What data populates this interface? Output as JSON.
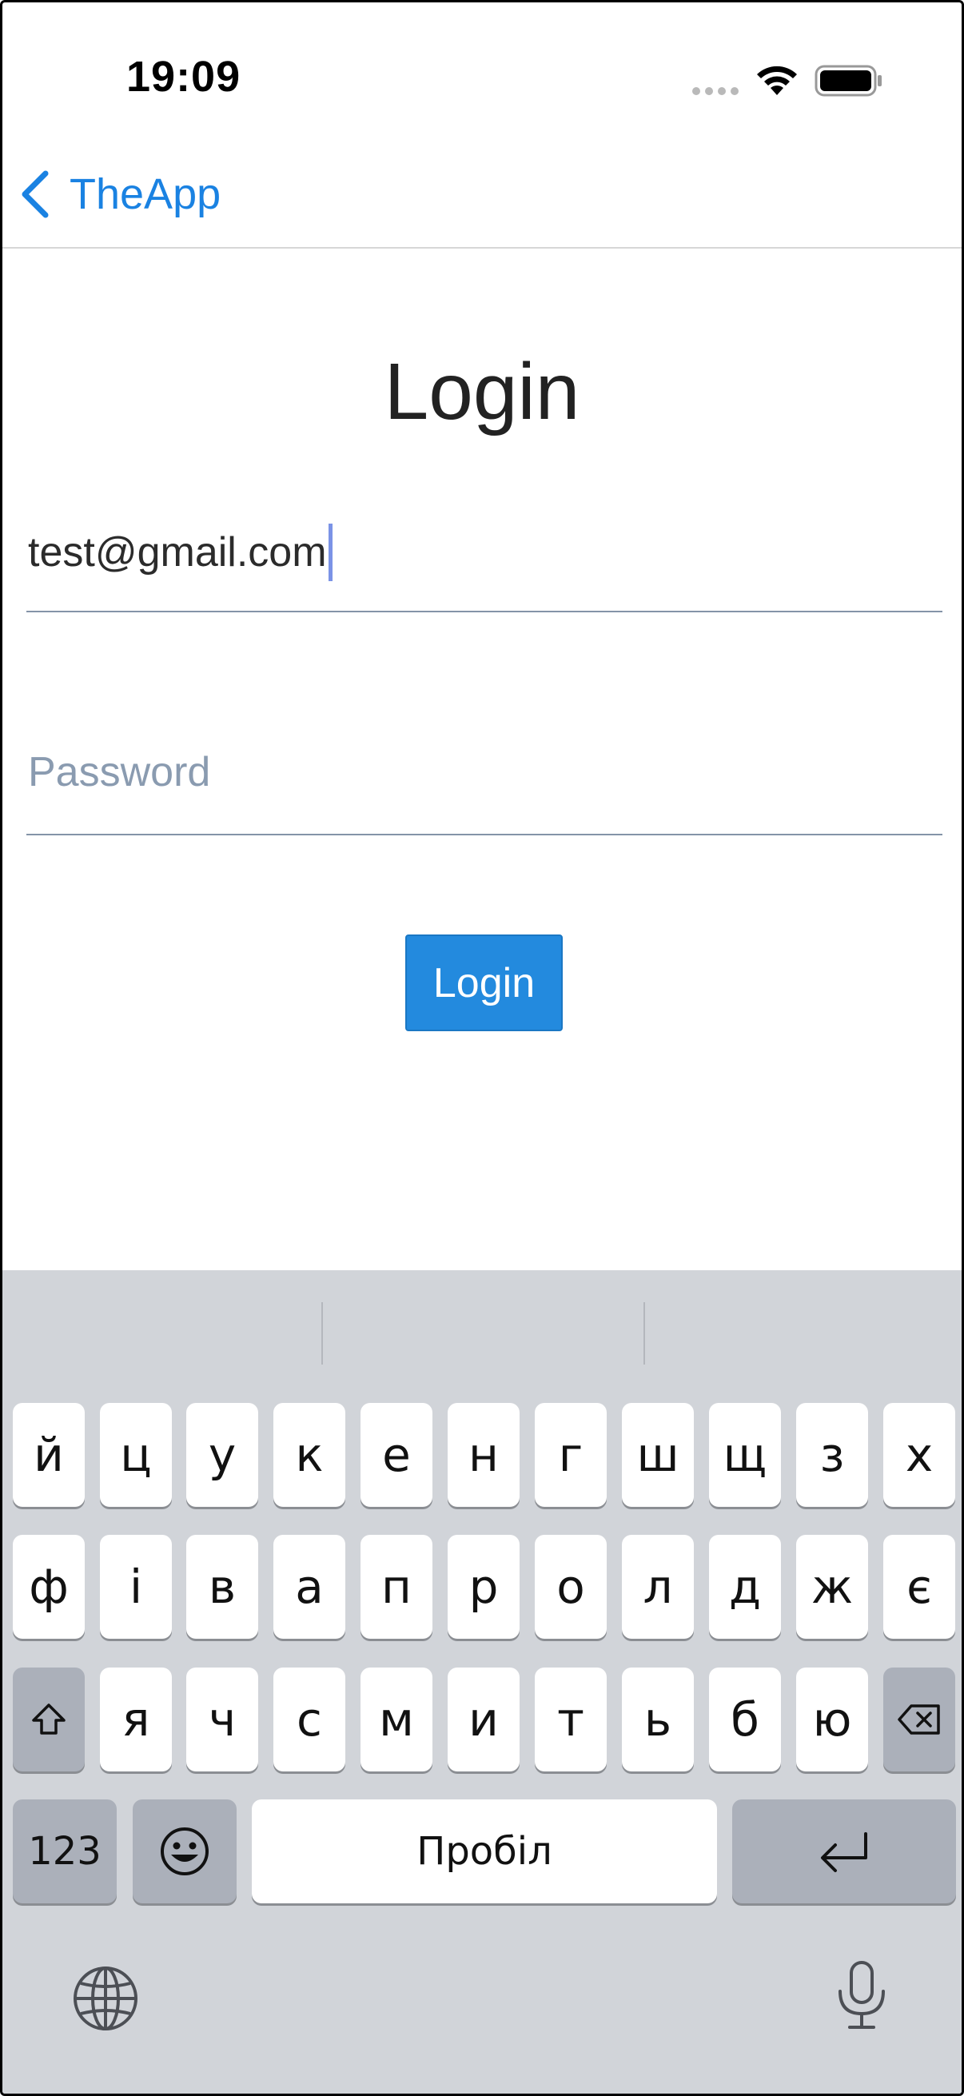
{
  "status_bar": {
    "time": "19:09",
    "icons": [
      "signal-dots-icon",
      "wifi-icon",
      "battery-icon"
    ]
  },
  "nav": {
    "back_label": "TheApp",
    "accent_color": "#1a82e2"
  },
  "page": {
    "title": "Login"
  },
  "form": {
    "email_value": "test@gmail.com",
    "password_placeholder": "Password",
    "login_button_label": "Login",
    "button_color": "#238ade"
  },
  "keyboard": {
    "row1": [
      "й",
      "ц",
      "у",
      "к",
      "е",
      "н",
      "г",
      "ш",
      "щ",
      "з",
      "х"
    ],
    "row2": [
      "ф",
      "і",
      "в",
      "а",
      "п",
      "р",
      "о",
      "л",
      "д",
      "ж",
      "є"
    ],
    "row3": [
      "я",
      "ч",
      "с",
      "м",
      "и",
      "т",
      "ь",
      "б",
      "ю"
    ],
    "numbers_label": "123",
    "space_label": "Пробіл",
    "icons": [
      "shift-icon",
      "backspace-icon",
      "emoji-icon",
      "return-icon",
      "globe-icon",
      "microphone-icon"
    ]
  }
}
